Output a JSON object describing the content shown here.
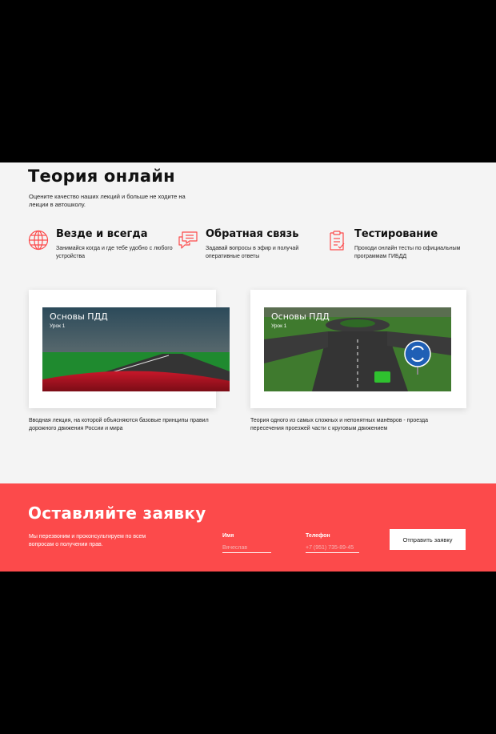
{
  "hero": {
    "title": "Теория онлайн",
    "subtitle": "Оцените качество наших лекций и больше не ходите на лекции в автошколу."
  },
  "features": [
    {
      "icon": "globe-icon",
      "title": "Везде и всегда",
      "text": "Занимайся когда и где тебе удобно с любого устройства"
    },
    {
      "icon": "chat-bubbles-icon",
      "title": "Обратная связь",
      "text": "Задавай вопросы в эфир и получай оперативные ответы"
    },
    {
      "icon": "clipboard-test-icon",
      "title": "Тестирование",
      "text": "Проходи онлайн тесты по официальным программам ГИБДД"
    }
  ],
  "videos": [
    {
      "title": "Основы ПДД",
      "lesson": "Урок 1",
      "description": "Вводная лекция, на которой объясняются базовые принципы правил дорожного движения России и мира"
    },
    {
      "title": "Основы ПДД",
      "lesson": "Урок 1",
      "description": "Теория одного из самых сложных и непонятных манёвров - проезда пересечения проезжей части с круговым движением"
    }
  ],
  "cta": {
    "title": "Оставляйте заявку",
    "text": "Мы перезвоним и проконсультируем по всем вопросам о получении прав.",
    "name_label": "Имя",
    "name_placeholder": "Вячеслав",
    "phone_label": "Телефон",
    "phone_placeholder": "+7 (951) 735-89-45",
    "submit_label": "Отправить заявку"
  },
  "colors": {
    "accent": "#fc4a4b",
    "background": "#f4f4f4",
    "letterbox": "#000000"
  }
}
